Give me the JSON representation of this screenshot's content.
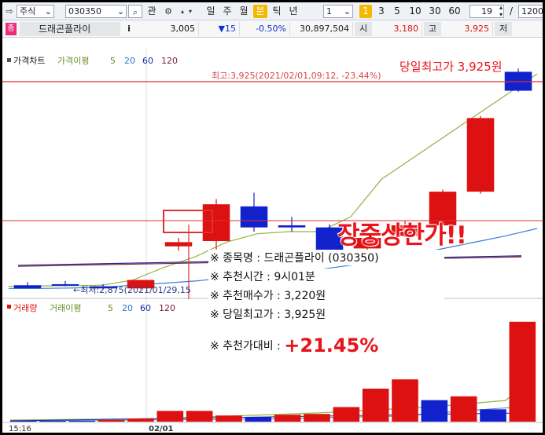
{
  "toolbar": {
    "market": "주식",
    "code": "030350",
    "search_icon": "magnifier-icon",
    "gwan": "관",
    "periods": [
      "일",
      "주",
      "월",
      "분",
      "틱",
      "년"
    ],
    "selected_period": "분",
    "interval": "1",
    "interval_buttons": [
      "3",
      "5",
      "10",
      "30",
      "60"
    ],
    "highlight_button": "1",
    "view_count": "19",
    "slash": "/",
    "total_count": "1200"
  },
  "quote": {
    "badge": "종",
    "name": "드래곤플라이",
    "info": "i",
    "price": "3,005",
    "change": "▼15",
    "change_rate": "-0.50%",
    "volume": "30,897,504",
    "open_label": "시",
    "open": "3,180",
    "high_label": "고",
    "high": "3,925",
    "low_label": "저"
  },
  "price_panel": {
    "legend_title": "가격차트",
    "legend_ma_title": "가격이평",
    "ma_periods": [
      "5",
      "20",
      "60",
      "120"
    ],
    "max_annotation": "최고:3,925(2021/02/01,09:12, -23.44%)",
    "min_annotation": "←최저:2,875(2021/01/29,15",
    "headline": "당일최고가 3,925원"
  },
  "volume_panel": {
    "legend_title": "거래량",
    "legend_ma_title": "거래이평",
    "ma_periods": [
      "5",
      "20",
      "60",
      "120"
    ]
  },
  "xaxis": {
    "left_time": "15:16",
    "date": "02/01"
  },
  "overlay": {
    "big_title": "장중상한가!!",
    "lines": [
      {
        "label": "※ 종목명 : 드래곤플라이 (030350)"
      },
      {
        "label": "※ 추천시간 : 9시01분"
      },
      {
        "label": "※ 추천매수가 : 3,220원"
      },
      {
        "label": "※ 당일최고가 : 3,925원"
      }
    ],
    "compare_label": "※ 추천가대비 :",
    "compare_value": "+21.45%"
  },
  "colors": {
    "up": "#dd1111",
    "down": "#1122cc",
    "ma5": "#8fb340",
    "ma20": "#3a7fd5",
    "ma60": "#1a2a9a",
    "ma120": "#7a1f3a",
    "accent": "#f5b800"
  },
  "chart_data": {
    "type": "candlestick",
    "unit": "1-minute",
    "candles": [
      {
        "o": 2895,
        "h": 2910,
        "l": 2885,
        "c": 2880,
        "dir": "down"
      },
      {
        "o": 2900,
        "h": 2915,
        "l": 2890,
        "c": 2895,
        "dir": "down"
      },
      {
        "o": 2880,
        "h": 2900,
        "l": 2875,
        "c": 2890,
        "dir": "down"
      },
      {
        "o": 2880,
        "h": 2920,
        "l": 2875,
        "c": 2920,
        "dir": "up"
      },
      {
        "o": 3080,
        "h": 3120,
        "l": 3060,
        "c": 3100,
        "dir": "up"
      },
      {
        "o": 3105,
        "h": 3305,
        "l": 3050,
        "c": 3280,
        "dir": "up"
      },
      {
        "o": 3270,
        "h": 3335,
        "l": 3150,
        "c": 3170,
        "dir": "down"
      },
      {
        "o": 3180,
        "h": 3220,
        "l": 3150,
        "c": 3170,
        "dir": "down"
      },
      {
        "o": 3170,
        "h": 3185,
        "l": 3030,
        "c": 3060,
        "dir": "down"
      },
      {
        "o": 3070,
        "h": 3130,
        "l": 3060,
        "c": 3120,
        "dir": "up"
      },
      {
        "o": 3130,
        "h": 3200,
        "l": 3125,
        "c": 3180,
        "dir": "up"
      },
      {
        "o": 3180,
        "h": 3350,
        "l": 3175,
        "c": 3340,
        "dir": "up"
      },
      {
        "o": 3340,
        "h": 3700,
        "l": 3330,
        "c": 3690,
        "dir": "up"
      },
      {
        "o": 3910,
        "h": 3925,
        "l": 3815,
        "c": 3820,
        "dir": "down"
      }
    ],
    "volumes": [
      {
        "v": 1,
        "dir": "down"
      },
      {
        "v": 1,
        "dir": "down"
      },
      {
        "v": 1,
        "dir": "down"
      },
      {
        "v": 2,
        "dir": "up"
      },
      {
        "v": 4,
        "dir": "up"
      },
      {
        "v": 14,
        "dir": "up"
      },
      {
        "v": 14,
        "dir": "up"
      },
      {
        "v": 8,
        "dir": "up"
      },
      {
        "v": 6,
        "dir": "down"
      },
      {
        "v": 9,
        "dir": "up"
      },
      {
        "v": 10,
        "dir": "up"
      },
      {
        "v": 19,
        "dir": "up"
      },
      {
        "v": 43,
        "dir": "up"
      },
      {
        "v": 55,
        "dir": "up"
      },
      {
        "v": 28,
        "dir": "down"
      },
      {
        "v": 33,
        "dir": "up"
      },
      {
        "v": 16,
        "dir": "down"
      },
      {
        "v": 130,
        "dir": "up"
      }
    ],
    "ma5": [
      2890,
      2892,
      2893,
      2895,
      2920,
      2980,
      3030,
      3100,
      3140,
      3150,
      3150,
      3220,
      3400,
      3500,
      3600,
      3700,
      3800,
      3900
    ],
    "ma20": [
      2880,
      2880,
      2882,
      2885,
      2895,
      2905,
      2915,
      2930,
      2950,
      2960,
      2970,
      2990,
      3010,
      3040,
      3070,
      3100,
      3130,
      3165
    ],
    "price_ylim": [
      2840,
      4020
    ],
    "volume_ylim": [
      0,
      140
    ]
  }
}
